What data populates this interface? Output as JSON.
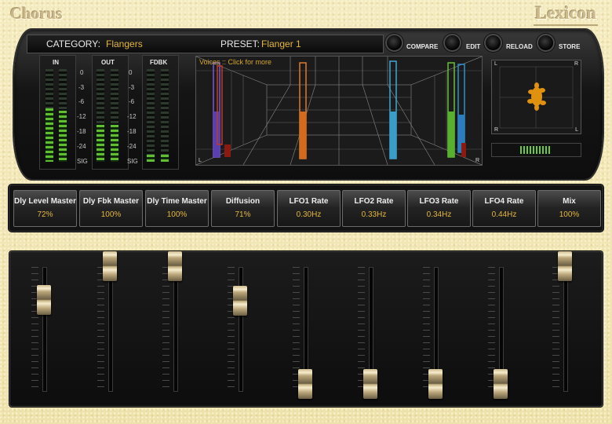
{
  "app": {
    "title": "Chorus",
    "brand": "Lexicon"
  },
  "header": {
    "category_label": "CATEGORY:",
    "category_value": "Flangers",
    "preset_label": "PRESET:",
    "preset_value": "Flanger 1",
    "buttons": [
      {
        "label": "COMPARE",
        "icon": "round-button-icon"
      },
      {
        "label": "EDIT",
        "icon": "round-button-icon"
      },
      {
        "label": "RELOAD",
        "icon": "round-button-icon"
      },
      {
        "label": "STORE",
        "icon": "round-button-icon"
      }
    ]
  },
  "meters": {
    "in_label": "IN",
    "out_label": "OUT",
    "fdbk_label": "FDBK",
    "scale": [
      "0",
      "-3",
      "-6",
      "-12",
      "-18",
      "-24",
      "SIG"
    ],
    "in_levels": [
      0.58,
      0.55
    ],
    "out_levels": [
      0.4,
      0.4
    ],
    "fdbk_levels": [
      0.08,
      0.08
    ]
  },
  "voices": {
    "text": "Voices :: Click for more",
    "corner_left": "L",
    "corner_right": "R"
  },
  "stereo": {
    "tl": "L",
    "tr": "R",
    "bl": "R",
    "br": "L"
  },
  "colors": {
    "accent": "#e3b63c",
    "meter_green": "#5fbf2e"
  },
  "params": [
    {
      "name": "Dly Level Master",
      "value": "72%"
    },
    {
      "name": "Dly Fbk Master",
      "value": "100%"
    },
    {
      "name": "Dly Time Master",
      "value": "100%"
    },
    {
      "name": "Diffusion",
      "value": "71%"
    },
    {
      "name": "LFO1 Rate",
      "value": "0.30Hz"
    },
    {
      "name": "LFO2 Rate",
      "value": "0.33Hz"
    },
    {
      "name": "LFO3 Rate",
      "value": "0.34Hz"
    },
    {
      "name": "LFO4 Rate",
      "value": "0.44Hz"
    },
    {
      "name": "Mix",
      "value": "100%"
    }
  ],
  "faders": [
    0.72,
    1.0,
    1.0,
    0.71,
    0.0,
    0.0,
    0.0,
    0.0,
    1.0
  ]
}
